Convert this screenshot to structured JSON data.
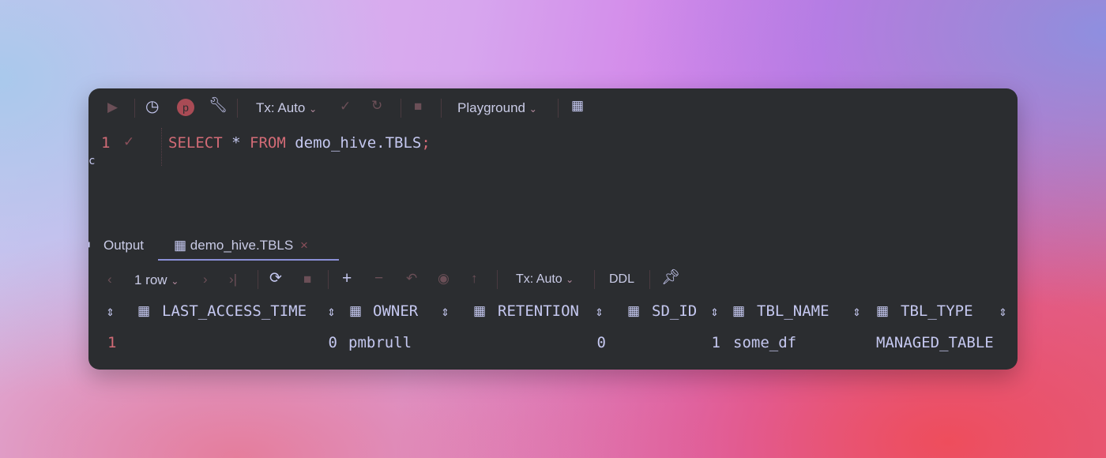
{
  "toolbar": {
    "tx_mode": "Tx: Auto",
    "schema": "Playground",
    "profile_letter": "p"
  },
  "editor": {
    "line_number": "1",
    "keyword_select": "SELECT",
    "star": "*",
    "keyword_from": "FROM",
    "table": "demo_hive.TBLS",
    "semicolon": ";",
    "gutter_letter": "c"
  },
  "tabs": {
    "output": "Output",
    "result": "demo_hive.TBLS",
    "close": "×"
  },
  "results_toolbar": {
    "rows": "1 row",
    "tx_mode": "Tx: Auto",
    "ddl": "DDL"
  },
  "table": {
    "columns": [
      "LAST_ACCESS_TIME",
      "OWNER",
      "RETENTION",
      "SD_ID",
      "TBL_NAME",
      "TBL_TYPE"
    ],
    "rows": [
      {
        "num": "1",
        "cells": [
          "0",
          "pmbrull",
          "0",
          "1",
          "some_df",
          "MANAGED_TABLE"
        ]
      }
    ]
  },
  "colors": {
    "keyword": "#d26b76",
    "identifier": "#c5c8f0",
    "window_bg": "#2b2d30",
    "tab_underline": "#8a8fd6"
  }
}
